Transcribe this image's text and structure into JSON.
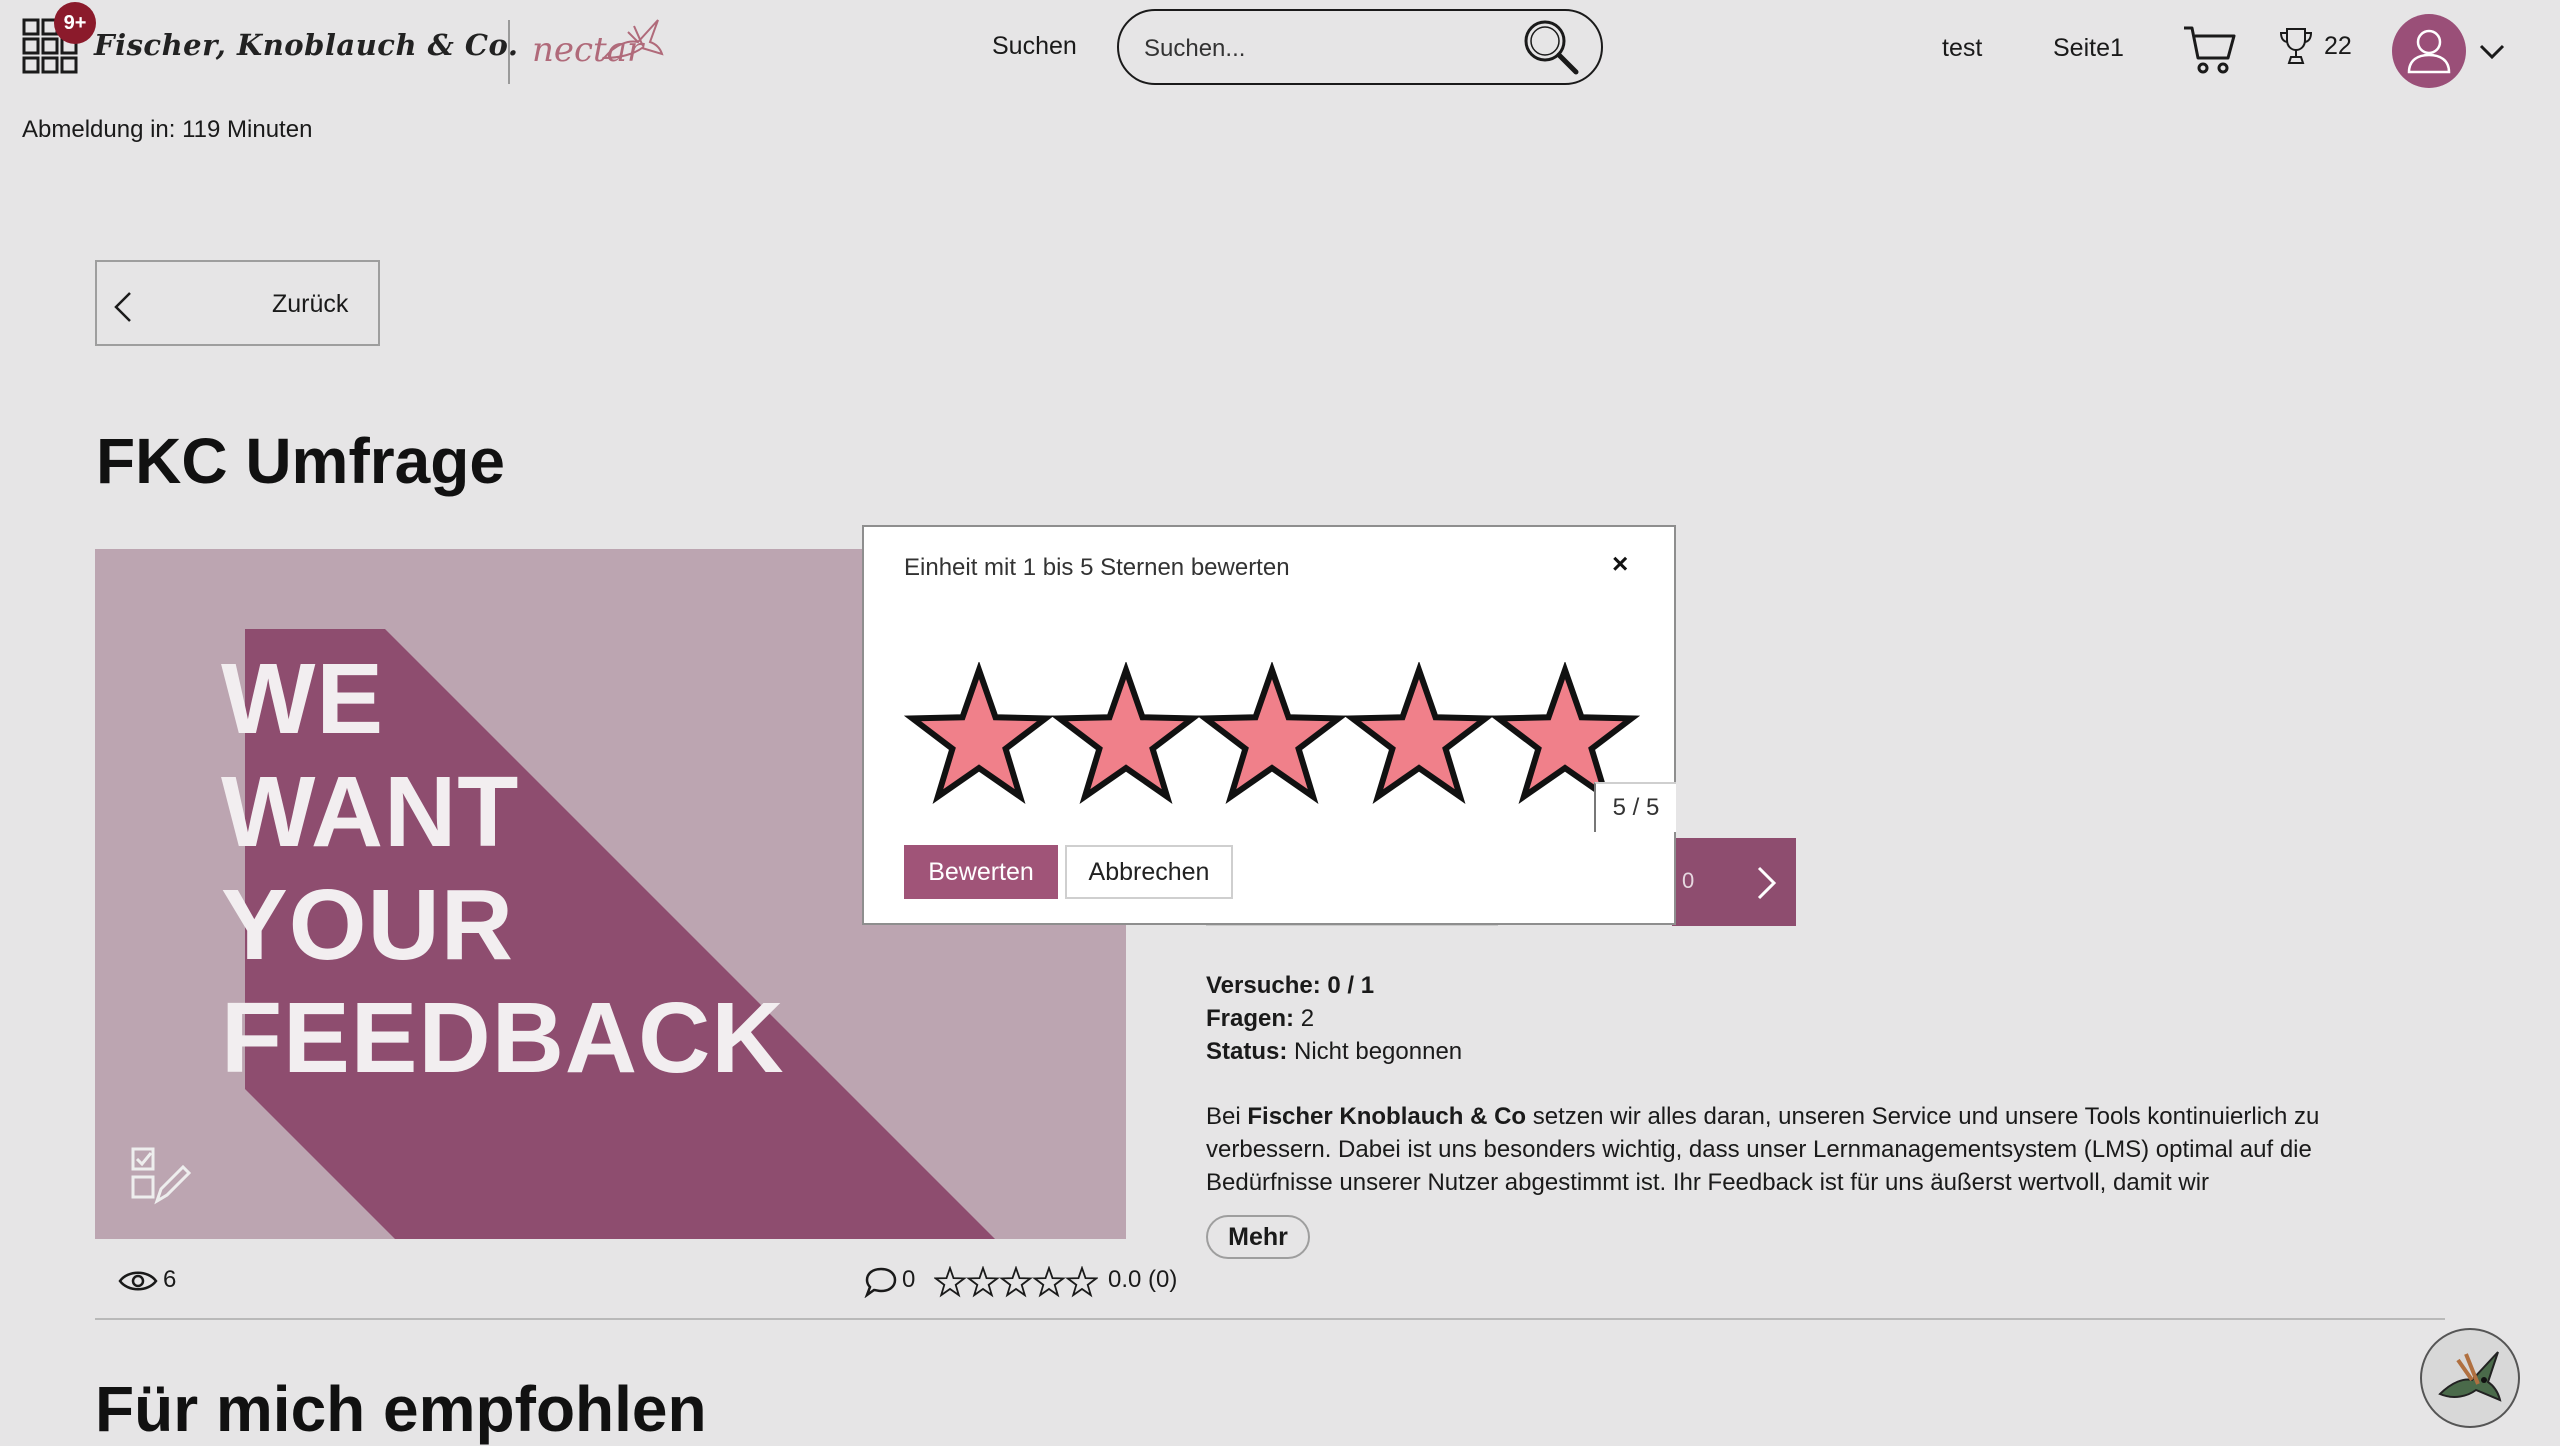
{
  "header": {
    "apps_badge": "9+",
    "brand_name": "Fischer, Knoblauch & Co.",
    "brand_sub": "nectar",
    "search_label": "Suchen",
    "search_placeholder": "Suchen...",
    "nav_links": [
      "test",
      "Seite1"
    ],
    "trophy_count": "22",
    "icons": [
      "apps-grid-icon",
      "search-icon",
      "cart-icon",
      "trophy-icon",
      "user-avatar-icon",
      "chevron-down-icon"
    ]
  },
  "logout_timer": "Abmeldung in: 119 Minuten",
  "back_button": "Zurück",
  "page_title": "FKC Umfrage",
  "feedback_image": {
    "lines": [
      "WE",
      "WANT",
      "YOUR",
      "FEEDBACK"
    ],
    "colors": {
      "background": "#bca5b1",
      "shadow": "#8e4d6f",
      "text": "#f2eef0"
    }
  },
  "stats": {
    "views": "6",
    "comments": "0",
    "rating_text": "0.0 (0)",
    "stars_filled": 0,
    "stars_total": 5
  },
  "info": {
    "attempts_label": "Versuche:",
    "attempts_value": "0 / 1",
    "questions_label": "Fragen:",
    "questions_value": "2",
    "status_label": "Status:",
    "status_value": "Nicht begonnen",
    "description_prefix": "Bei",
    "description_company": "Fischer Knoblauch & Co",
    "description_rest": "setzen wir alles daran, unseren Service und unsere Tools kontinuierlich zu verbessern. Dabei ist uns besonders wichtig, dass unser Lernmanagementsystem (LMS) optimal auf die Bedürfnisse unserer Nutzer abgestimmt ist. Ihr Feedback ist für uns äußerst wertvoll, damit wir",
    "more_button": "Mehr"
  },
  "pager": {
    "number": "0"
  },
  "recommended_title": "Für mich empfohlen",
  "modal": {
    "title": "Einheit mit 1 bis 5 Sternen bewerten",
    "close": "×",
    "rating": 5,
    "rating_counter": "5 / 5",
    "star_fill": "#f0808a",
    "confirm_button": "Bewerten",
    "cancel_button": "Abbrechen",
    "accent_color": "#a05478"
  }
}
